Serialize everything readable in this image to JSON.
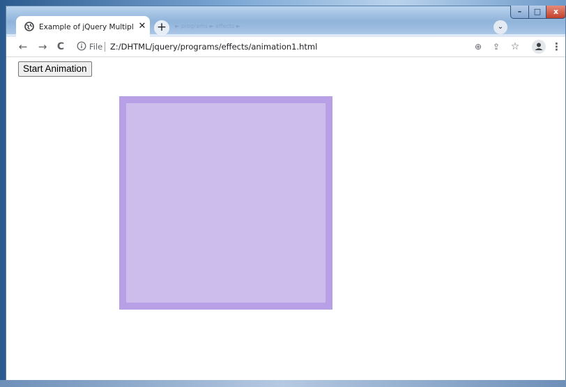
{
  "browser": {
    "tab_title": "Example of jQuery Multiple Prop",
    "tab_close": "✕",
    "new_tab": "+",
    "background_tab_text": "► programs ► effects ►",
    "tab_list": "⌄"
  },
  "window_controls": {
    "minimize": "–",
    "maximize": "□",
    "close": "x"
  },
  "toolbar": {
    "back": "←",
    "forward": "→",
    "reload": "C",
    "site_info_label": "File",
    "url": "Z:/DHTML/jquery/programs/effects/animation1.html",
    "zoom_icon": "⊕",
    "share_icon": "⇪",
    "bookmark_icon": "☆",
    "menu": "⋮"
  },
  "page": {
    "start_button": "Start Animation",
    "box_fill_color": "#cdbded",
    "box_border_color": "#b7a0e6"
  }
}
